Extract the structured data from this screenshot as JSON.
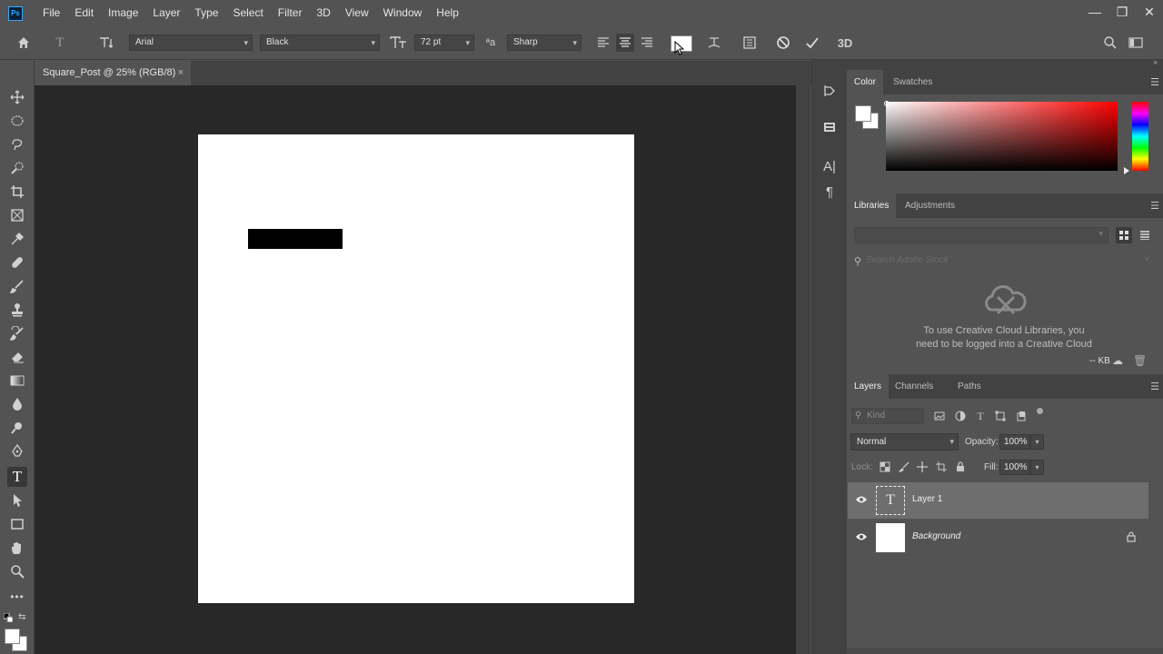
{
  "app": {
    "logo": "Ps"
  },
  "menu": [
    "File",
    "Edit",
    "Image",
    "Layer",
    "Type",
    "Select",
    "Filter",
    "3D",
    "View",
    "Window",
    "Help"
  ],
  "window_controls": {
    "minimize": "—",
    "restore": "❐",
    "close": "✕"
  },
  "options_bar": {
    "font_family": "Arial",
    "font_style": "Black",
    "font_size": "72 pt",
    "antialias": "Sharp",
    "threed_label": "3D",
    "tool_glyph": "T"
  },
  "document": {
    "tab_title": "Square_Post @ 25% (RGB/8)",
    "close_glyph": "×"
  },
  "color_panel": {
    "tabs": [
      "Color",
      "Swatches"
    ],
    "foreground": "#ffffff",
    "background": "#ffffff"
  },
  "libraries_panel": {
    "tabs": [
      "Libraries",
      "Adjustments"
    ],
    "search_placeholder": "Search Adobe Stock",
    "message_line1": "To use Creative Cloud Libraries, you",
    "message_line2": "need to be logged into a Creative Cloud",
    "storage": "-- KB"
  },
  "layers_panel": {
    "tabs": [
      "Layers",
      "Channels",
      "Paths"
    ],
    "kind_placeholder": "Kind",
    "blend_mode": "Normal",
    "opacity_label": "Opacity:",
    "opacity_value": "100%",
    "lock_label": "Lock:",
    "fill_label": "Fill:",
    "fill_value": "100%",
    "layers": [
      {
        "name": "Layer 1",
        "type": "text",
        "selected": true,
        "visible": true
      },
      {
        "name": "Background",
        "type": "background",
        "selected": false,
        "visible": true,
        "locked": true
      }
    ]
  },
  "icons": {
    "eye": "eye-icon",
    "lock": "lock-icon",
    "menu": "panel-menu-icon"
  },
  "colors": {
    "ui_bg": "#535353",
    "canvas_bg": "#282828",
    "accent": "#31a8ff"
  }
}
